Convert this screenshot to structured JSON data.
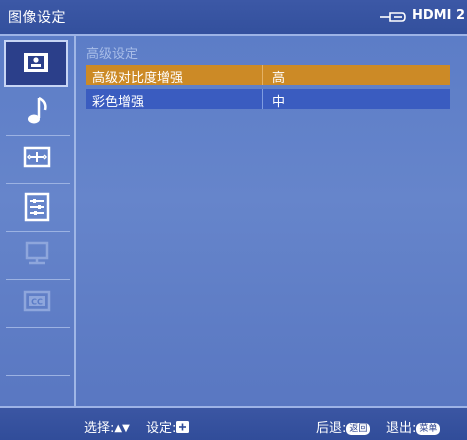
{
  "header": {
    "title": "图像设定",
    "input_source": "HDMI 2",
    "input_icon": "input-source-icon"
  },
  "sidebar": {
    "items": [
      {
        "name": "picture",
        "icon": "picture-icon",
        "active": true
      },
      {
        "name": "sound",
        "icon": "music-note-icon",
        "active": false
      },
      {
        "name": "screen",
        "icon": "screen-icon",
        "active": false
      },
      {
        "name": "setup",
        "icon": "settings-list-icon",
        "active": false
      },
      {
        "name": "pc",
        "icon": "pc-monitor-icon",
        "active": false,
        "disabled": true
      },
      {
        "name": "caption",
        "icon": "cc-icon",
        "active": false,
        "disabled": true
      }
    ]
  },
  "main": {
    "section_title": "高级设定",
    "rows": [
      {
        "label": "高级对比度增强",
        "value": "高",
        "selected": true
      },
      {
        "label": "彩色增强",
        "value": "中",
        "selected": false
      }
    ]
  },
  "footer": {
    "select_label": "选择:",
    "select_keys": "▲▼",
    "set_label": "设定:",
    "back_label": "后退:",
    "back_key": "返回",
    "exit_label": "退出:",
    "exit_key": "菜单"
  },
  "colors": {
    "background": "#6685cb",
    "title_bar": "#3c58a6",
    "selected_row": "#cc8a26",
    "normal_row": "#3a5cc0",
    "section_title": "#a8bde8"
  }
}
